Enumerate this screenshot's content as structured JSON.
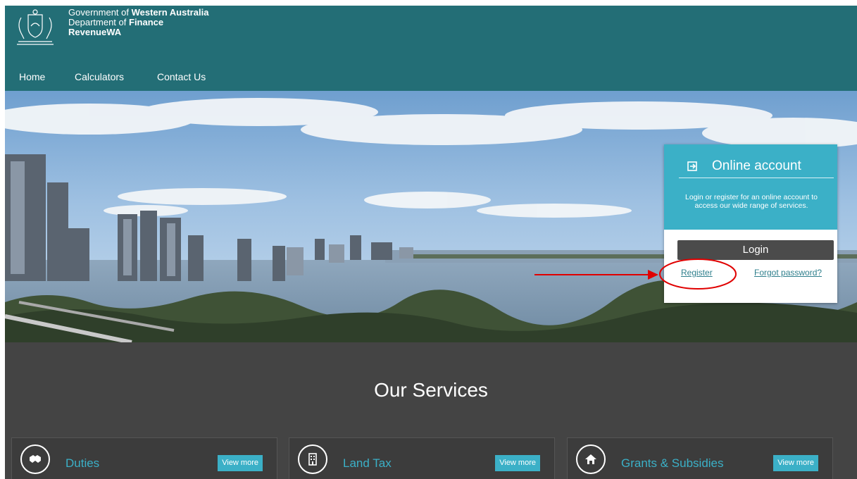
{
  "header": {
    "brand_line1_prefix": "Government of ",
    "brand_line1_bold": "Western Australia",
    "brand_line2_prefix": "Department of ",
    "brand_line2_bold": "Finance",
    "brand_line3": "RevenueWA",
    "crest_icon": "wa-government-crest-icon"
  },
  "nav": {
    "items": [
      {
        "label": "Home"
      },
      {
        "label": "Calculators"
      },
      {
        "label": "Contact Us"
      }
    ]
  },
  "account_panel": {
    "title": "Online account",
    "icon": "sign-in-icon",
    "description": "Login or register for an online account to access our wide range of services.",
    "login_label": "Login",
    "register_label": "Register",
    "forgot_label": "Forgot password?"
  },
  "services": {
    "title": "Our Services",
    "cards": [
      {
        "label": "Duties",
        "icon": "handshake-icon",
        "button": "View more"
      },
      {
        "label": "Land Tax",
        "icon": "building-icon",
        "button": "View more"
      },
      {
        "label": "Grants & Subsidies",
        "icon": "home-icon",
        "button": "View more"
      }
    ]
  },
  "colors": {
    "header_bg": "#236e76",
    "accent": "#3bb0c7",
    "services_bg": "#444444",
    "annotation": "#e00000"
  }
}
